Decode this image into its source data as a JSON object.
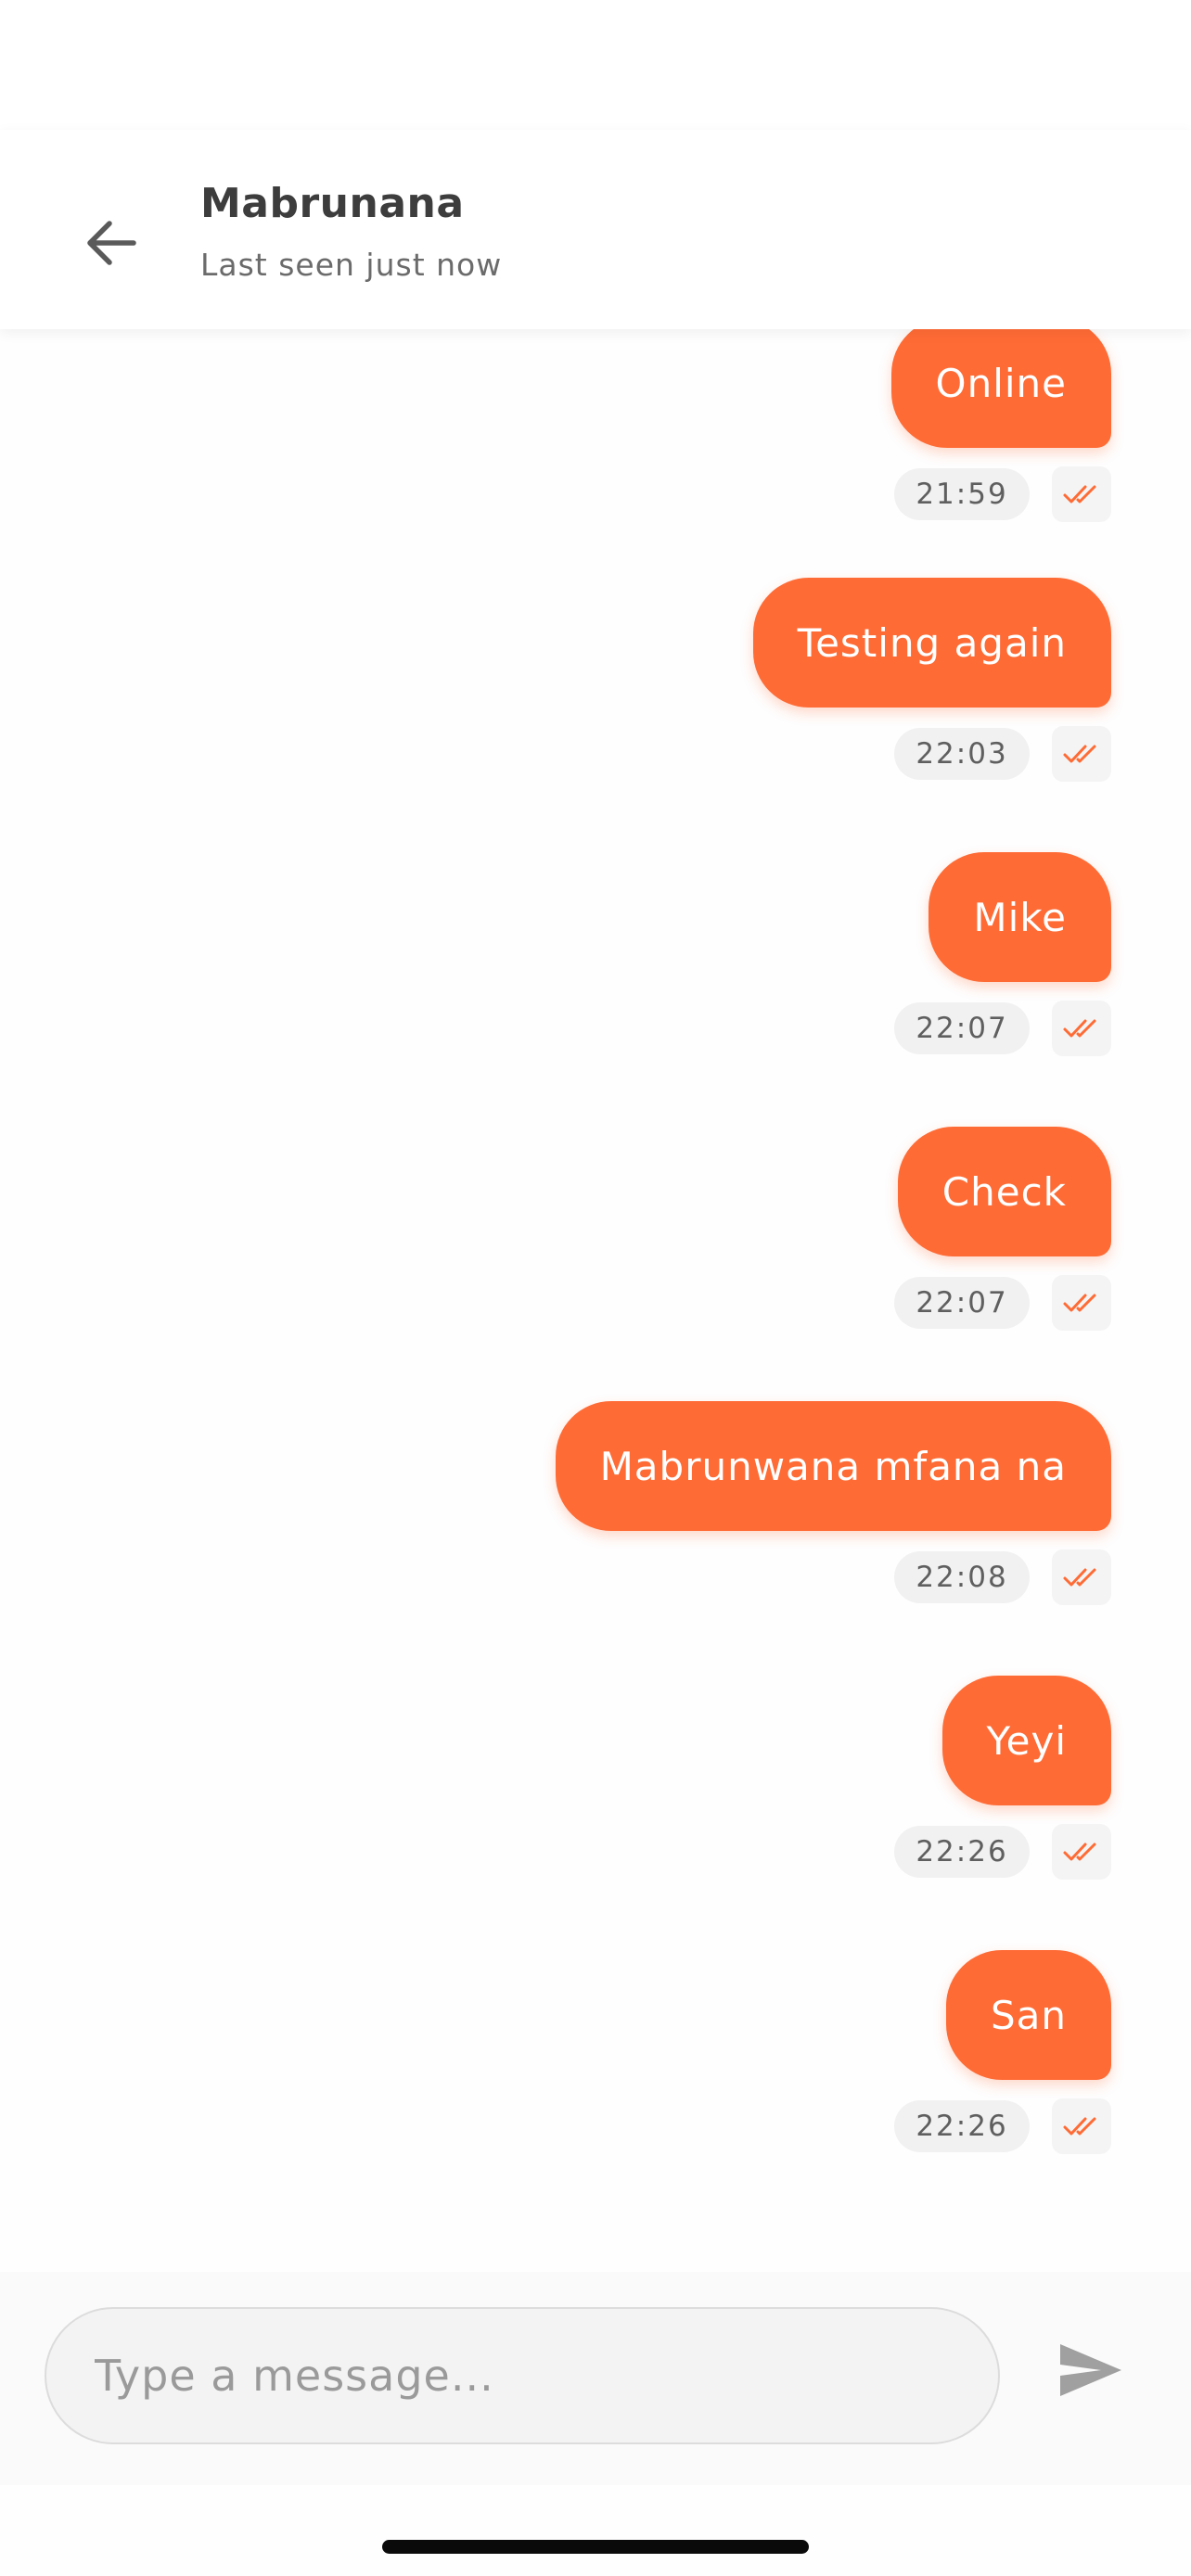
{
  "header": {
    "contact_name": "Mabrunana",
    "status": "Last seen just now",
    "back_icon": "arrow-left-icon"
  },
  "messages": [
    {
      "text": "Online",
      "time": "21:59",
      "status_icon": "double-check-icon"
    },
    {
      "text": "Testing again",
      "time": "22:03",
      "status_icon": "double-check-icon"
    },
    {
      "text": "Mike",
      "time": "22:07",
      "status_icon": "double-check-icon"
    },
    {
      "text": "Check",
      "time": "22:07",
      "status_icon": "double-check-icon"
    },
    {
      "text": "Mabrunwana mfana na",
      "time": "22:08",
      "status_icon": "double-check-icon"
    },
    {
      "text": "Yeyi",
      "time": "22:26",
      "status_icon": "double-check-icon"
    },
    {
      "text": "San",
      "time": "22:26",
      "status_icon": "double-check-icon"
    }
  ],
  "composer": {
    "placeholder": "Type a message...",
    "value": "",
    "send_icon": "send-icon"
  },
  "colors": {
    "accent": "#ff6b35",
    "bubble_text": "#ffffff",
    "timestamp_bg": "#f1f1f1"
  }
}
